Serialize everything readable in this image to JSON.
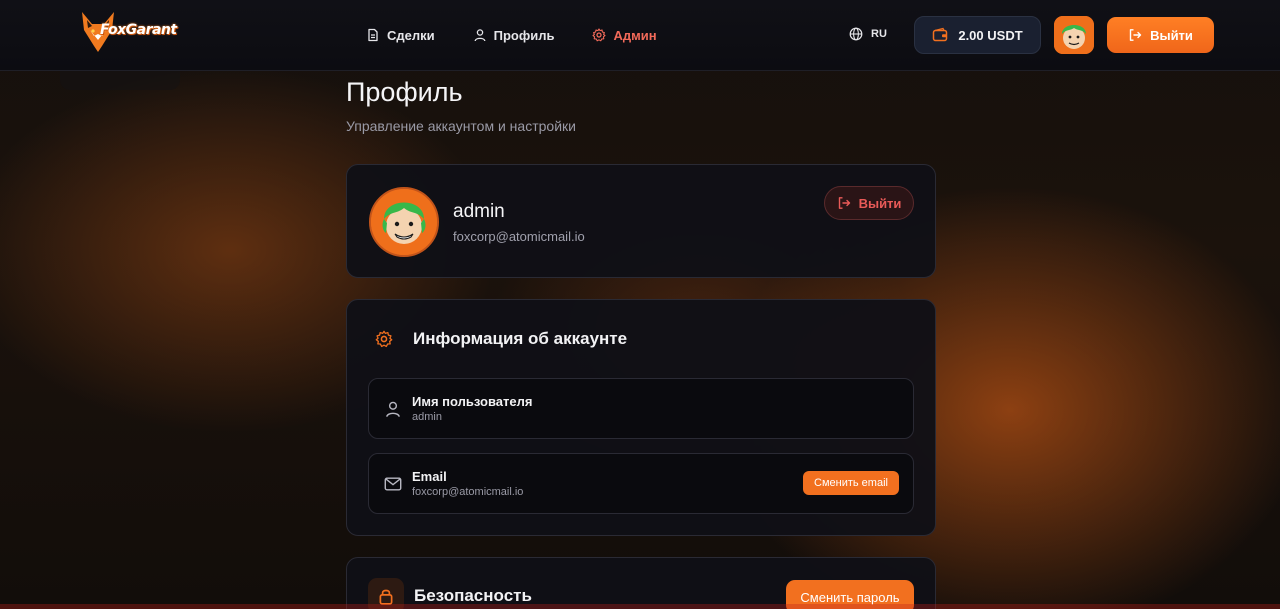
{
  "brand": {
    "name": "FoxGarant"
  },
  "nav": {
    "items": [
      {
        "label": "Сделки",
        "icon": "document-icon",
        "active": false
      },
      {
        "label": "Профиль",
        "icon": "user-icon",
        "active": false
      },
      {
        "label": "Админ",
        "icon": "gear-icon",
        "active": true
      }
    ]
  },
  "header": {
    "language": "RU",
    "balance": "2.00 USDT",
    "logout_label": "Выйти"
  },
  "page": {
    "title": "Профиль",
    "subtitle": "Управление аккаунтом и настройки"
  },
  "profile": {
    "username": "admin",
    "email": "foxcorp@atomicmail.io",
    "logout_label": "Выйти"
  },
  "account_info": {
    "title": "Информация об аккаунте",
    "username_field": {
      "label": "Имя пользователя",
      "value": "admin"
    },
    "email_field": {
      "label": "Email",
      "value": "foxcorp@atomicmail.io",
      "button": "Сменить email"
    }
  },
  "security": {
    "title": "Безопасность",
    "button": "Сменить пароль"
  },
  "colors": {
    "accent": "#f2701f",
    "active_nav": "#f26a5a",
    "danger": "#e95a58"
  }
}
